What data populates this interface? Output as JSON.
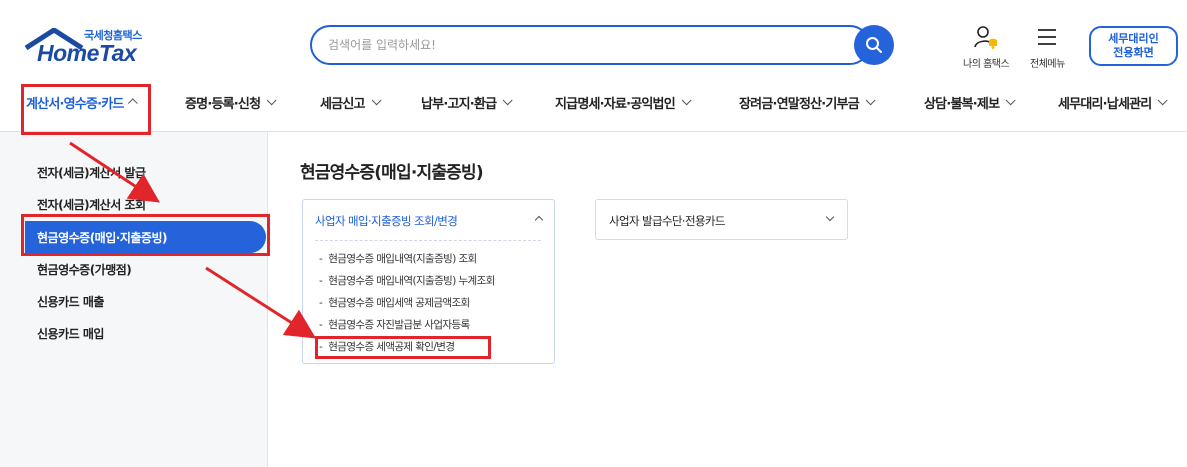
{
  "header": {
    "logo_small": "국세청홈택스",
    "logo_main": "HomeTax",
    "search_placeholder": "검색어를 입력하세요!",
    "my_hometax": "나의 홈택스",
    "all_menu": "전체메뉴",
    "tax_agent_line1": "세무대리인",
    "tax_agent_line2": "전용화면"
  },
  "gnb": [
    {
      "label": "계산서·영수증·카드"
    },
    {
      "label": "증명·등록·신청"
    },
    {
      "label": "세금신고"
    },
    {
      "label": "납부·고지·환급"
    },
    {
      "label": "지급명세·자료·공익법인"
    },
    {
      "label": "장려금·연말정산·기부금"
    },
    {
      "label": "상담·불복·제보"
    },
    {
      "label": "세무대리·납세관리"
    }
  ],
  "side": [
    {
      "label": "전자(세금)계산서 발급"
    },
    {
      "label": "전자(세금)계산서 조회"
    },
    {
      "label": "현금영수증(매입·지출증빙)"
    },
    {
      "label": "현금영수증(가맹점)"
    },
    {
      "label": "신용카드 매출"
    },
    {
      "label": "신용카드 매입"
    }
  ],
  "content": {
    "title": "현금영수증(매입·지출증빙)",
    "panel1_title": "사업자 매입·지출증빙 조회/변경",
    "panel1_items": [
      {
        "label": "현금영수증 매입내역(지출증빙) 조회"
      },
      {
        "label": "현금영수증 매입내역(지출증빙) 누계조회"
      },
      {
        "label": "현금영수증 매입세액 공제금액조회"
      },
      {
        "label": "현금영수증 자진발급분 사업자등록"
      },
      {
        "label": "현금영수증 세액공제 확인/변경"
      }
    ],
    "panel2_title": "사업자 발급수단·전용카드"
  },
  "colors": {
    "brand_blue": "#2563db",
    "annotation_red": "#e0262b"
  }
}
